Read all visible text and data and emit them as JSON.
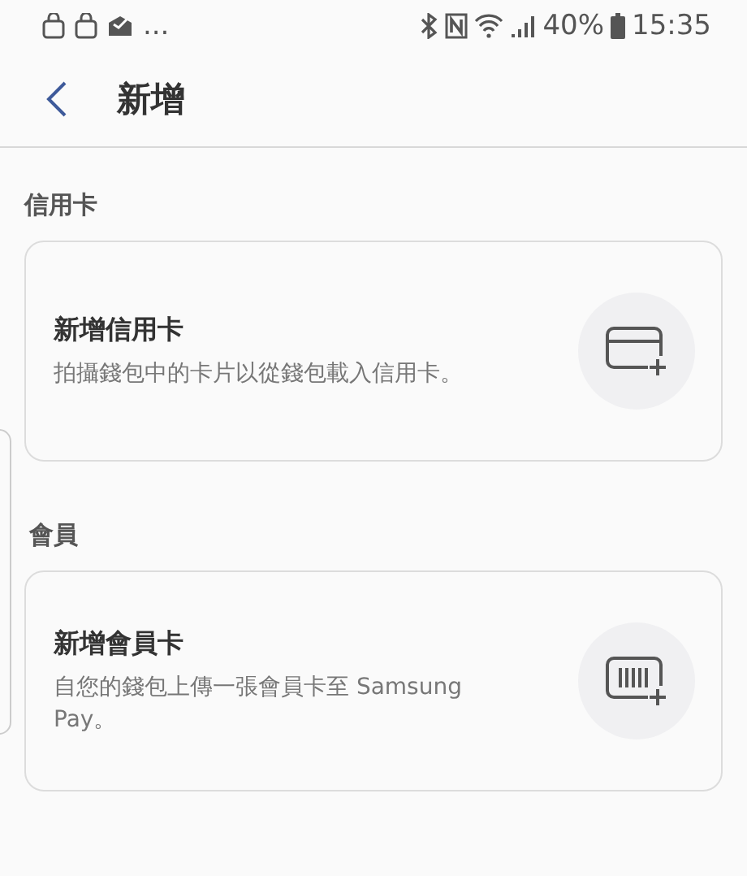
{
  "status_bar": {
    "notification_more": "...",
    "battery": "40%",
    "time": "15:35"
  },
  "header": {
    "title": "新增"
  },
  "sections": [
    {
      "label": "信用卡",
      "card": {
        "kind": "credit",
        "title": "新增信用卡",
        "description": "拍攝錢包中的卡片以從錢包載入信用卡。"
      }
    },
    {
      "label": "會員",
      "card": {
        "kind": "membership",
        "title": "新增會員卡",
        "description": "自您的錢包上傳一張會員卡至 Samsung Pay。"
      }
    }
  ]
}
